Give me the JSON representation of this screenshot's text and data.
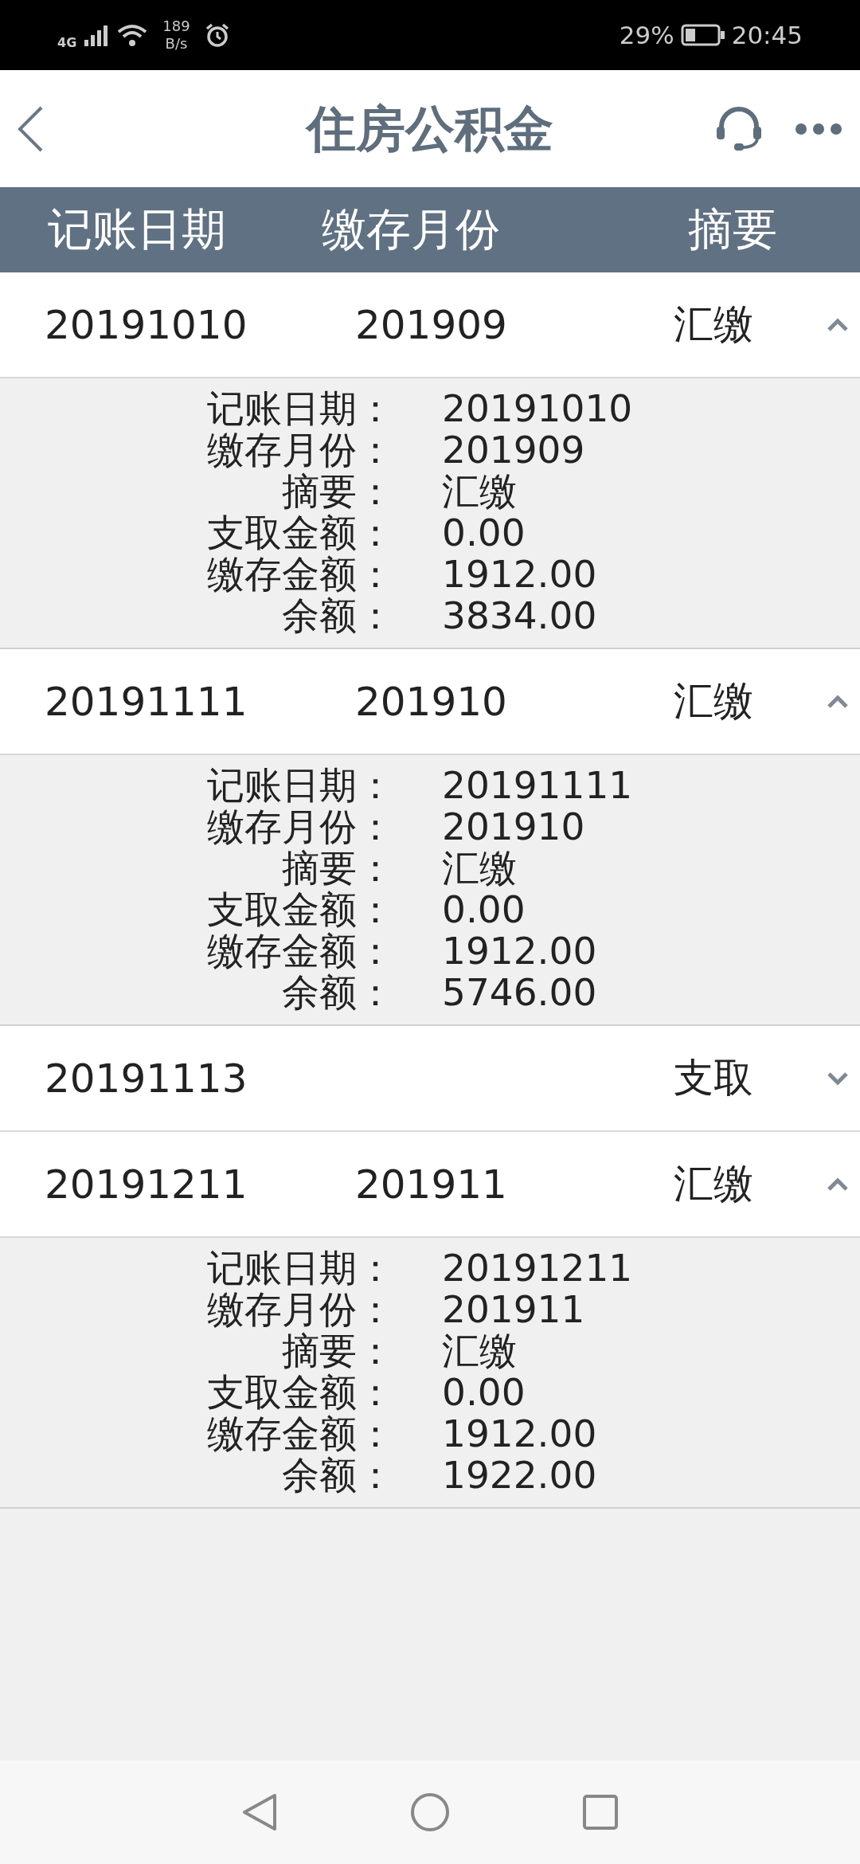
{
  "status_bar": {
    "network": "4G",
    "speed_value": "189",
    "speed_unit": "B/s",
    "battery": "29%",
    "time": "20:45"
  },
  "header": {
    "title": "住房公积金"
  },
  "columns": [
    "记账日期",
    "缴存月份",
    "摘要"
  ],
  "records": [
    {
      "date": "20191010",
      "month": "201909",
      "summary": "汇缴",
      "expanded": true,
      "details": [
        {
          "label": "记账日期：",
          "value": "20191010"
        },
        {
          "label": "缴存月份：",
          "value": "201909"
        },
        {
          "label": "摘要：",
          "value": "汇缴"
        },
        {
          "label": "支取金额：",
          "value": "0.00"
        },
        {
          "label": "缴存金额：",
          "value": "1912.00"
        },
        {
          "label": "余额：",
          "value": "3834.00"
        }
      ]
    },
    {
      "date": "20191111",
      "month": "201910",
      "summary": "汇缴",
      "expanded": true,
      "details": [
        {
          "label": "记账日期：",
          "value": "20191111"
        },
        {
          "label": "缴存月份：",
          "value": "201910"
        },
        {
          "label": "摘要：",
          "value": "汇缴"
        },
        {
          "label": "支取金额：",
          "value": "0.00"
        },
        {
          "label": "缴存金额：",
          "value": "1912.00"
        },
        {
          "label": "余额：",
          "value": "5746.00"
        }
      ]
    },
    {
      "date": "20191113",
      "summary": "支取",
      "expanded": false
    },
    {
      "date": "20191211",
      "month": "201911",
      "summary": "汇缴",
      "expanded": true,
      "details": [
        {
          "label": "记账日期：",
          "value": "20191211"
        },
        {
          "label": "缴存月份：",
          "value": "201911"
        },
        {
          "label": "摘要：",
          "value": "汇缴"
        },
        {
          "label": "支取金额：",
          "value": "0.00"
        },
        {
          "label": "缴存金额：",
          "value": "1912.00"
        },
        {
          "label": "余额：",
          "value": "1922.00"
        }
      ]
    }
  ]
}
